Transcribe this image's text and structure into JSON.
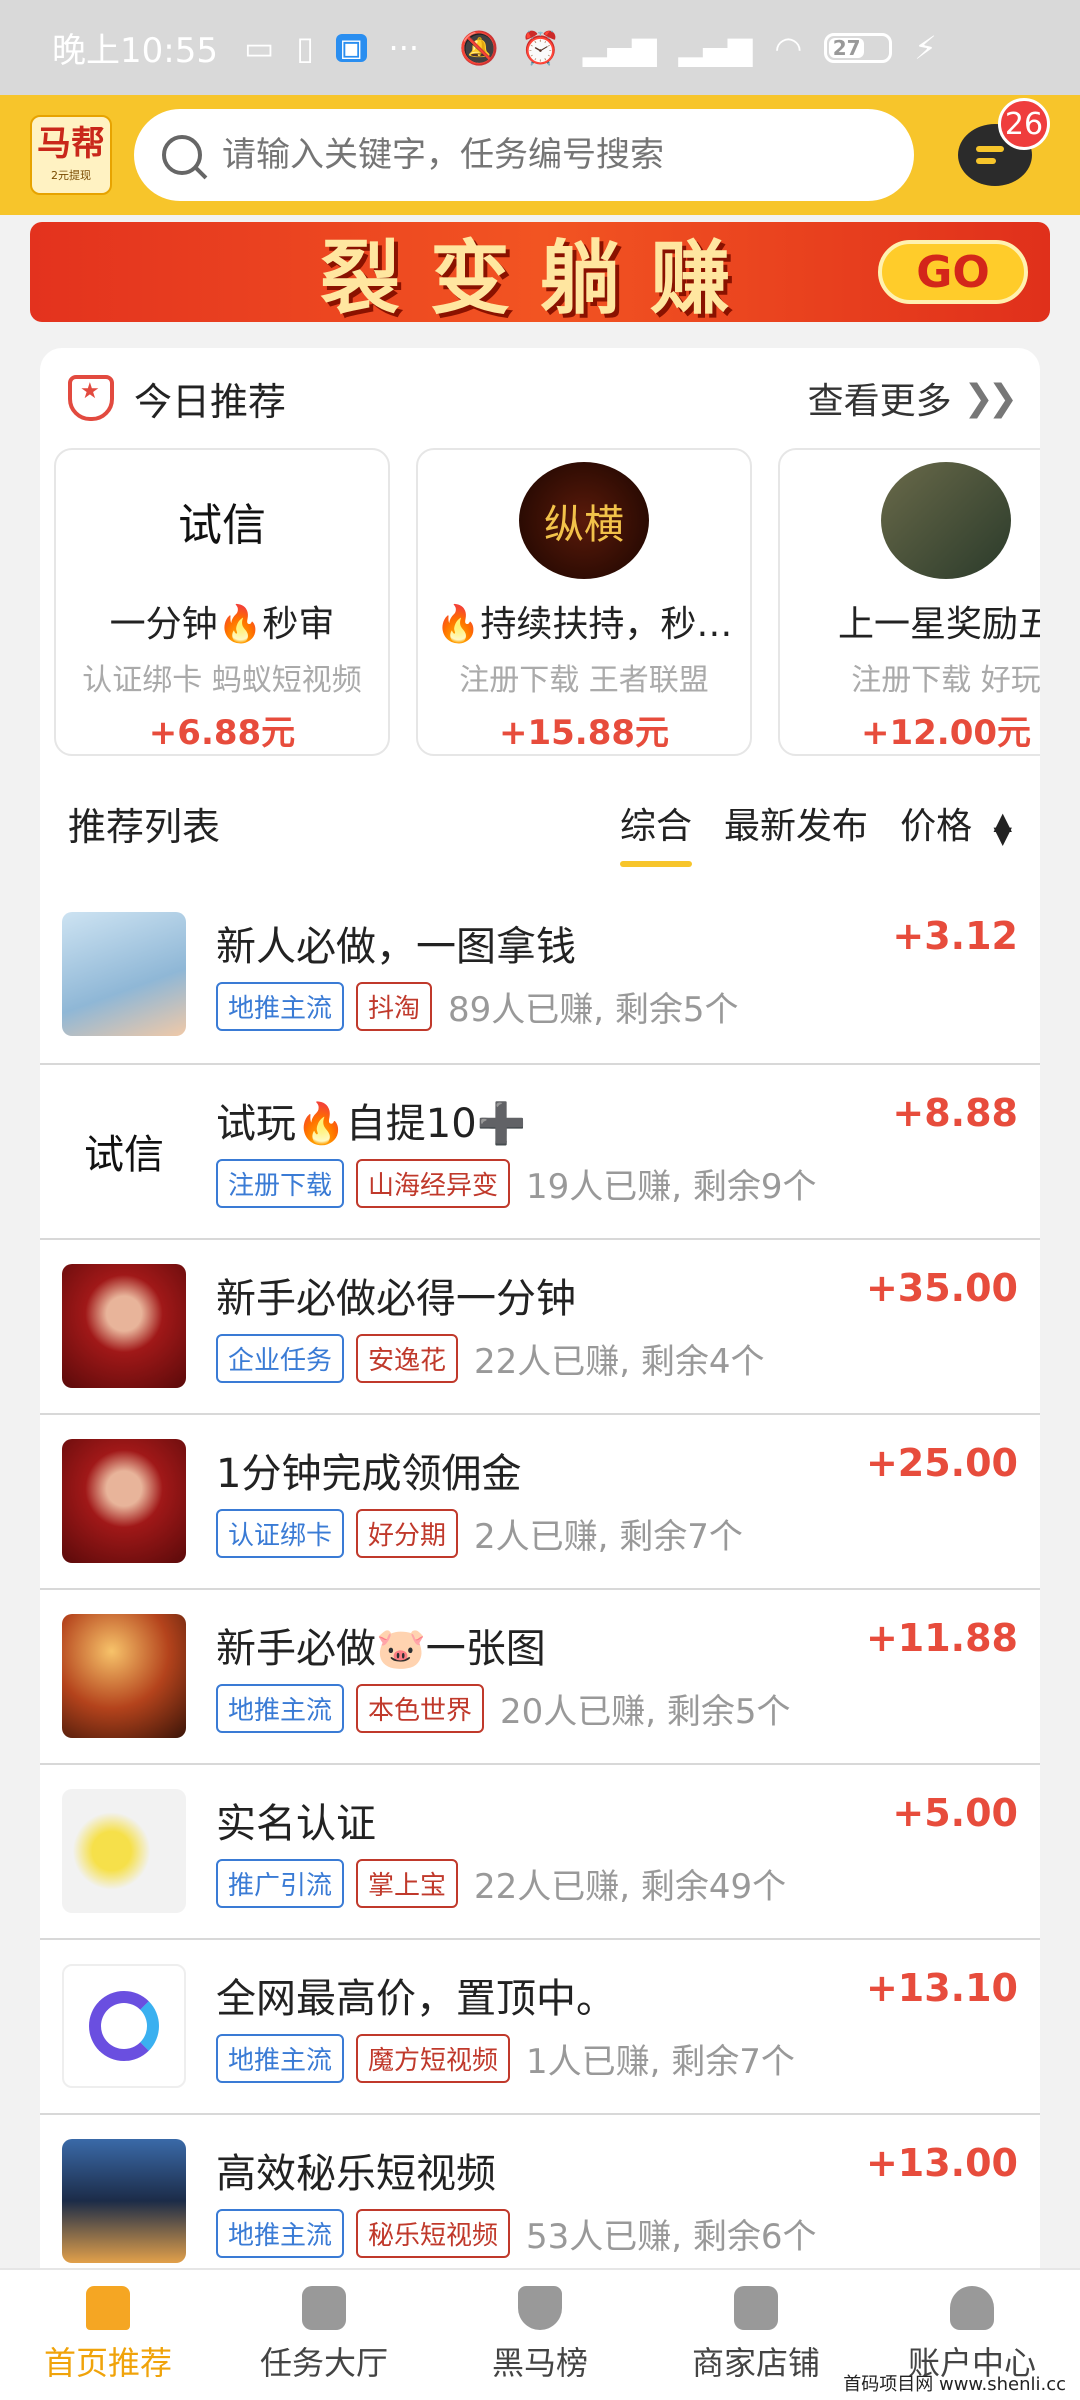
{
  "status": {
    "time": "晚上10:55",
    "battery": "27"
  },
  "header": {
    "logo_text": "马帮",
    "logo_sub": "2元提现",
    "search_placeholder": "请输入关键字，任务编号搜索",
    "message_badge": "26"
  },
  "banner": {
    "text": "裂变躺赚",
    "go": "GO"
  },
  "today": {
    "title": "今日推荐",
    "see_more": "查看更多",
    "items": [
      {
        "title": "一分钟🔥秒审",
        "sub": "认证绑卡 蚂蚁短视频",
        "price": "+6.88元",
        "avatar_text": "试信"
      },
      {
        "title": "🔥持续扶持，秒…",
        "sub": "注册下载 王者联盟",
        "price": "+15.88元",
        "avatar_text": "纵横"
      },
      {
        "title": "上一星奖励五",
        "sub": "注册下载 好玩",
        "price": "+12.00元",
        "avatar_text": ""
      }
    ]
  },
  "list": {
    "title": "推荐列表",
    "sort": [
      "综合",
      "最新发布",
      "价格"
    ],
    "items": [
      {
        "name": "新人必做，一图拿钱",
        "tag1": "地推主流",
        "tag2": "抖淘",
        "stat": "89人已赚, 剩余5个",
        "price": "+3.12",
        "thumb": "#b9d3e8"
      },
      {
        "name": "试玩🔥自提10➕",
        "tag1": "注册下载",
        "tag2": "山海经异变",
        "stat": "19人已赚, 剩余9个",
        "price": "+8.88",
        "thumb": "#ffffff"
      },
      {
        "name": "新手必做必得一分钟",
        "tag1": "企业任务",
        "tag2": "安逸花",
        "stat": "22人已赚, 剩余4个",
        "price": "+35.00",
        "thumb": "#a01818"
      },
      {
        "name": "1分钟完成领佣金",
        "tag1": "认证绑卡",
        "tag2": "好分期",
        "stat": "2人已赚, 剩余7个",
        "price": "+25.00",
        "thumb": "#a01818"
      },
      {
        "name": "新手必做🐷一张图",
        "tag1": "地推主流",
        "tag2": "本色世界",
        "stat": "20人已赚, 剩余5个",
        "price": "+11.88",
        "thumb": "#c56a2a"
      },
      {
        "name": "实名认证",
        "tag1": "推广引流",
        "tag2": "掌上宝",
        "stat": "22人已赚, 剩余49个",
        "price": "+5.00",
        "thumb": "#f4f4f4"
      },
      {
        "name": "全网最高价，置顶中。",
        "tag1": "地推主流",
        "tag2": "魔方短视频",
        "stat": "1人已赚, 剩余7个",
        "price": "+13.10",
        "thumb": "#ffffff"
      },
      {
        "name": "高效秘乐短视频",
        "tag1": "地推主流",
        "tag2": "秘乐短视频",
        "stat": "53人已赚, 剩余6个",
        "price": "+13.00",
        "thumb": "#2c4b7a"
      }
    ]
  },
  "tabbar": [
    "首页推荐",
    "任务大厅",
    "黑马榜",
    "商家店铺",
    "账户中心"
  ],
  "watermark": "首码项目网 www.shenli.cc"
}
